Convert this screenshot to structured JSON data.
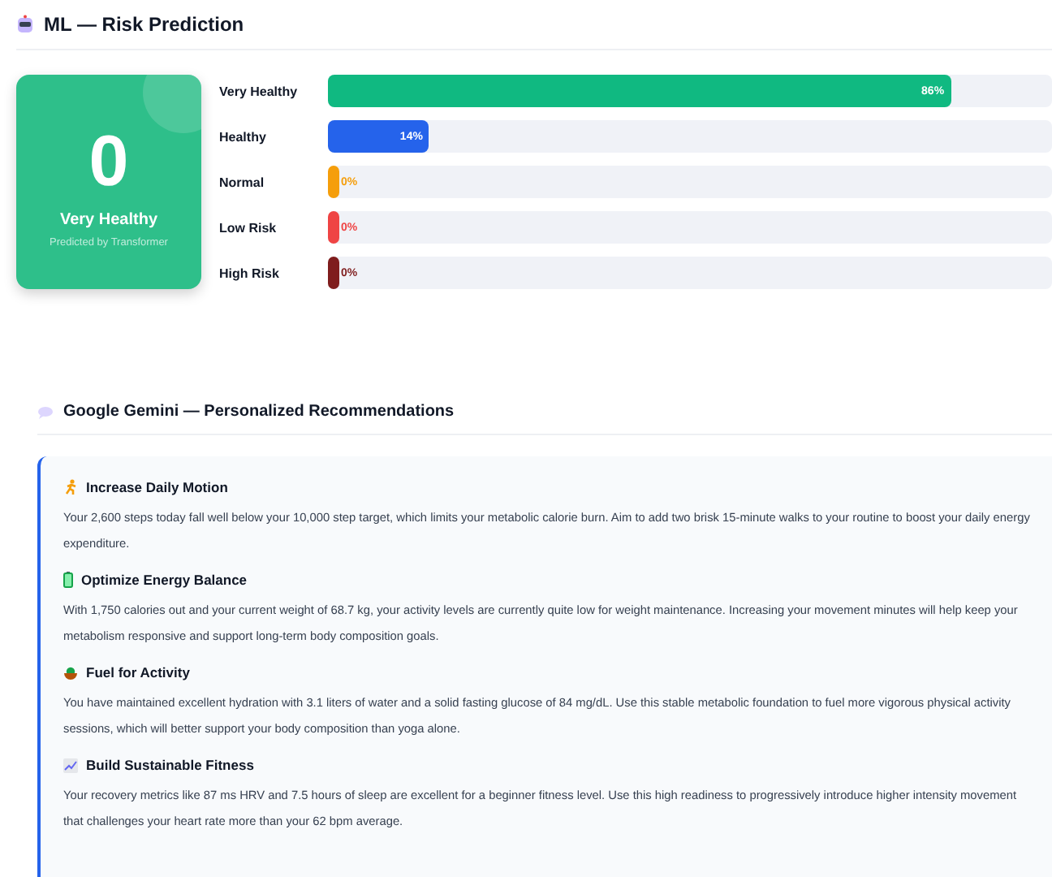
{
  "ml_section": {
    "title": "ML — Risk Prediction",
    "result_card": {
      "value": "0",
      "label": "Very Healthy",
      "caption": "Predicted by Transformer"
    },
    "bars": [
      {
        "label": "Very Healthy",
        "level": 0.86,
        "reading": "86%",
        "color": "#10b981"
      },
      {
        "label": "Healthy",
        "level": 0.14,
        "reading": "14%",
        "color": "#2563eb"
      },
      {
        "label": "Normal",
        "level": 0,
        "reading": "0%",
        "color": "#f59e0b"
      },
      {
        "label": "Low Risk",
        "level": 0,
        "reading": "0%",
        "color": "#ef4444"
      },
      {
        "label": "High Risk",
        "level": 0,
        "reading": "0%",
        "color": "#7f1d1d"
      }
    ]
  },
  "gemini_section": {
    "title": "Google Gemini — Personalized Recommendations",
    "recommendations": [
      {
        "kind": "runner",
        "title": "Increase Daily Motion",
        "text": "Your 2,600 steps today fall well below your 10,000 step target, which limits your metabolic calorie burn. Aim to add two brisk 15-minute walks to your routine to boost your daily energy expenditure."
      },
      {
        "kind": "battery",
        "title": "Optimize Energy Balance",
        "text": "With 1,750 calories out and your current weight of 68.7 kg, your activity levels are currently quite low for weight maintenance. Increasing your movement minutes will help keep your metabolism responsive and support long-term body composition goals."
      },
      {
        "kind": "bowl",
        "title": "Fuel for Activity",
        "text": "You have maintained excellent hydration with 3.1 liters of water and a solid fasting glucose of 84 mg/dL. Use this stable metabolic foundation to fuel more vigorous physical activity sessions, which will better support your body composition than yoga alone."
      },
      {
        "kind": "chart",
        "title": "Build Sustainable Fitness",
        "text": "Your recovery metrics like 87 ms HRV and 7.5 hours of sleep are excellent for a beginner fitness level. Use this high readiness to progressively introduce higher intensity movement that challenges your heart rate more than your 62 bpm average."
      }
    ]
  }
}
